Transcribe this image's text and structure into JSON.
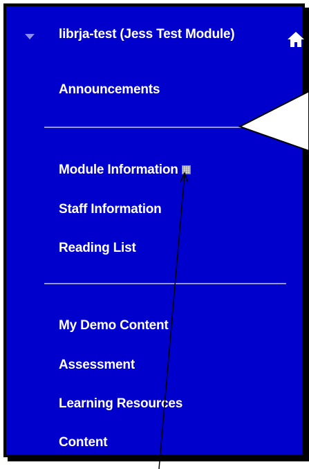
{
  "course": {
    "title": "librja-test (Jess Test Module)",
    "expand_icon": "triangle-down-icon",
    "home_icon": "home-icon"
  },
  "menu": {
    "group1": [
      "Announcements"
    ],
    "group2": [
      "Module Information",
      "Staff Information",
      "Reading List"
    ],
    "group3_heading": "My Demo Content",
    "group3": [
      "Assessment",
      "Learning Resources",
      "Content"
    ]
  },
  "colors": {
    "panel_bg": "#0000cc",
    "text": "#ffffff",
    "divider": "#9a9ad9"
  }
}
